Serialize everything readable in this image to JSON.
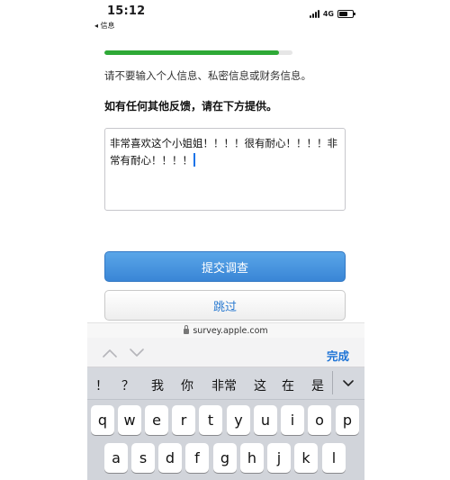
{
  "status": {
    "time": "15:12",
    "back_app": "◂ 信息",
    "network": "4G",
    "battery_level": 0.65
  },
  "survey": {
    "progress": 0.93,
    "notice": "请不要输入个人信息、私密信息或财务信息。",
    "question": "如有任何其他反馈，请在下方提供。",
    "feedback_value": "非常喜欢这个小姐姐！！！！很有耐心！！！！非常有耐心！！！！",
    "submit_label": "提交调查",
    "skip_label": "跳过"
  },
  "browser": {
    "url": "survey.apple.com"
  },
  "accessory": {
    "done_label": "完成"
  },
  "keyboard": {
    "candidates": [
      "！",
      "？",
      "我",
      "你",
      "非常",
      "这",
      "在",
      "是"
    ],
    "row1": [
      "q",
      "w",
      "e",
      "r",
      "t",
      "y",
      "u",
      "i",
      "o",
      "p"
    ],
    "row2": [
      "a",
      "s",
      "d",
      "f",
      "g",
      "h",
      "j",
      "k",
      "l"
    ]
  },
  "colors": {
    "progress": "#2ea936",
    "accent": "#1d73d6",
    "submit": "#3a86d6"
  }
}
